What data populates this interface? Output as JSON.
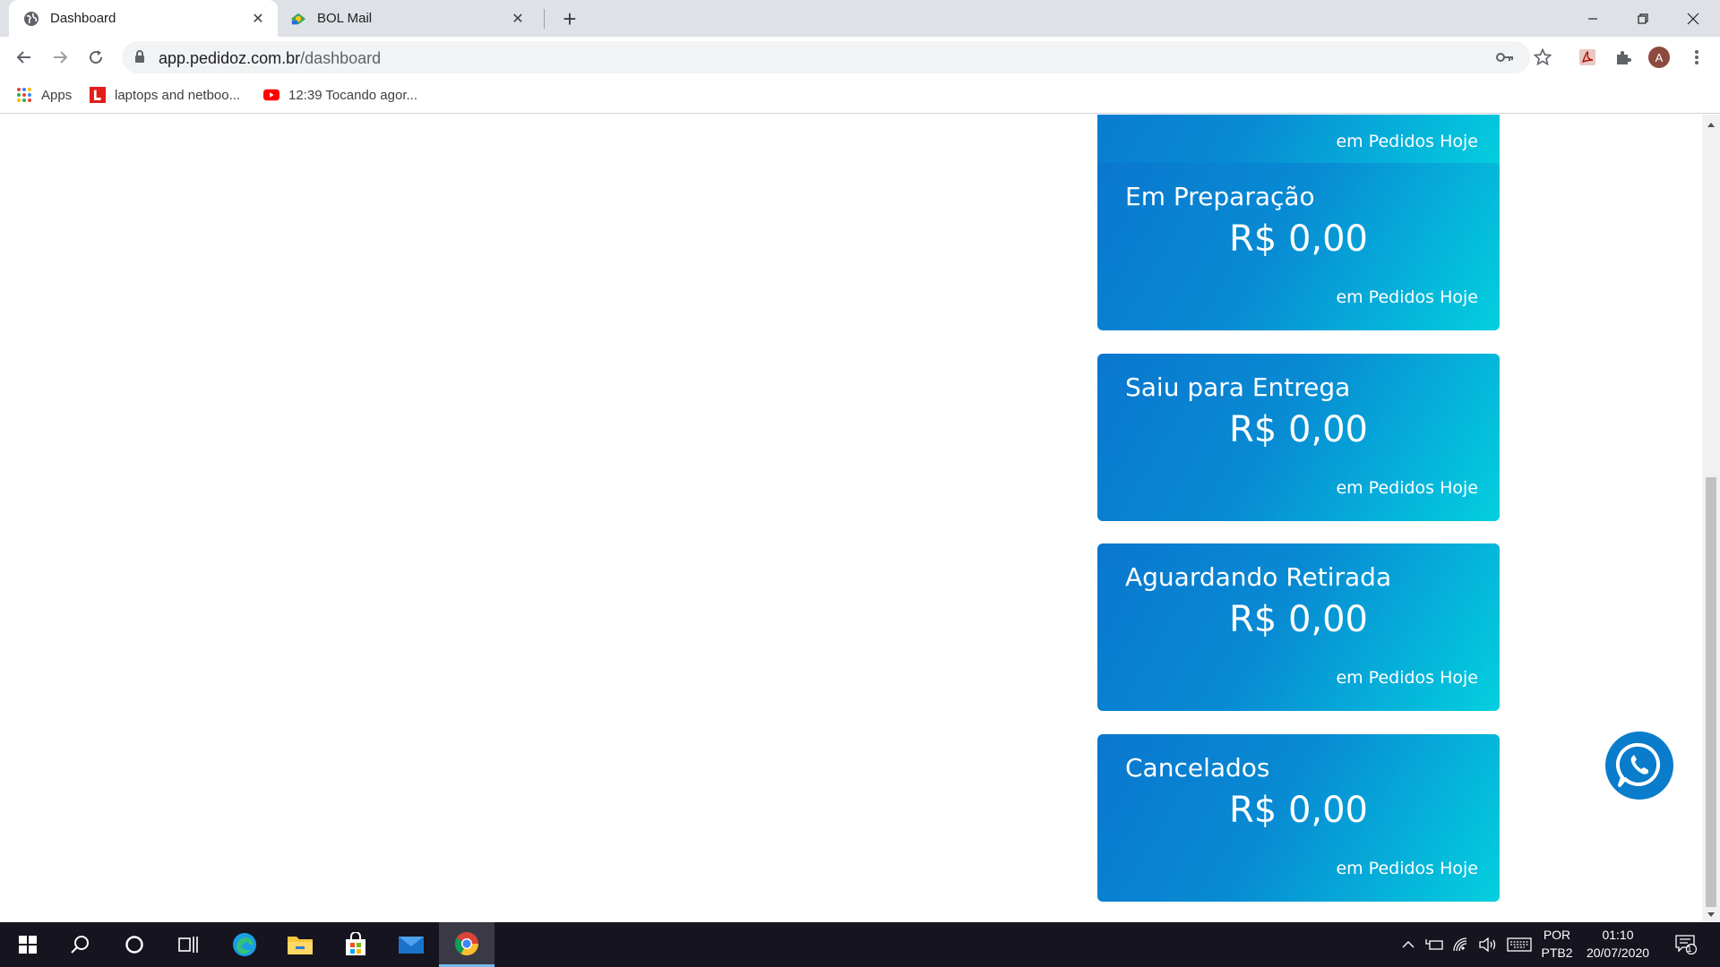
{
  "browser": {
    "tabs": [
      {
        "title": "Dashboard",
        "favicon": "globe-icon",
        "active": true
      },
      {
        "title": "BOL Mail",
        "favicon": "bol-mail-icon",
        "active": false
      }
    ],
    "url": {
      "host": "app.pedidoz.com.br",
      "path": "/dashboard"
    },
    "profile_initial": "A",
    "bookmarks": [
      {
        "label": "Apps",
        "icon": "apps-grid-icon"
      },
      {
        "label": "laptops and netboo...",
        "icon": "l-logo-icon"
      },
      {
        "label": "12:39 Tocando agor...",
        "icon": "youtube-icon"
      }
    ]
  },
  "dashboard": {
    "cards": [
      {
        "title": "",
        "value": "",
        "subtitle": "em Pedidos Hoje"
      },
      {
        "title": "Em Preparação",
        "value": "R$ 0,00",
        "subtitle": "em Pedidos Hoje"
      },
      {
        "title": "Saiu para Entrega",
        "value": "R$ 0,00",
        "subtitle": "em Pedidos Hoje"
      },
      {
        "title": "Aguardando Retirada",
        "value": "R$ 0,00",
        "subtitle": "em Pedidos Hoje"
      },
      {
        "title": "Cancelados",
        "value": "R$ 0,00",
        "subtitle": "em Pedidos Hoje"
      }
    ],
    "card_gradient": [
      "#0a77cf",
      "#03cfdf"
    ],
    "whatsapp_icon": "whatsapp-icon"
  },
  "taskbar": {
    "apps": [
      "start-icon",
      "search-icon",
      "cortana-icon",
      "task-view-icon",
      "edge-icon",
      "file-explorer-icon",
      "store-icon",
      "mail-icon",
      "chrome-icon"
    ],
    "language": {
      "line1": "POR",
      "line2": "PTB2"
    },
    "clock": {
      "time": "01:10",
      "date": "20/07/2020"
    },
    "notifications_count": "1"
  }
}
